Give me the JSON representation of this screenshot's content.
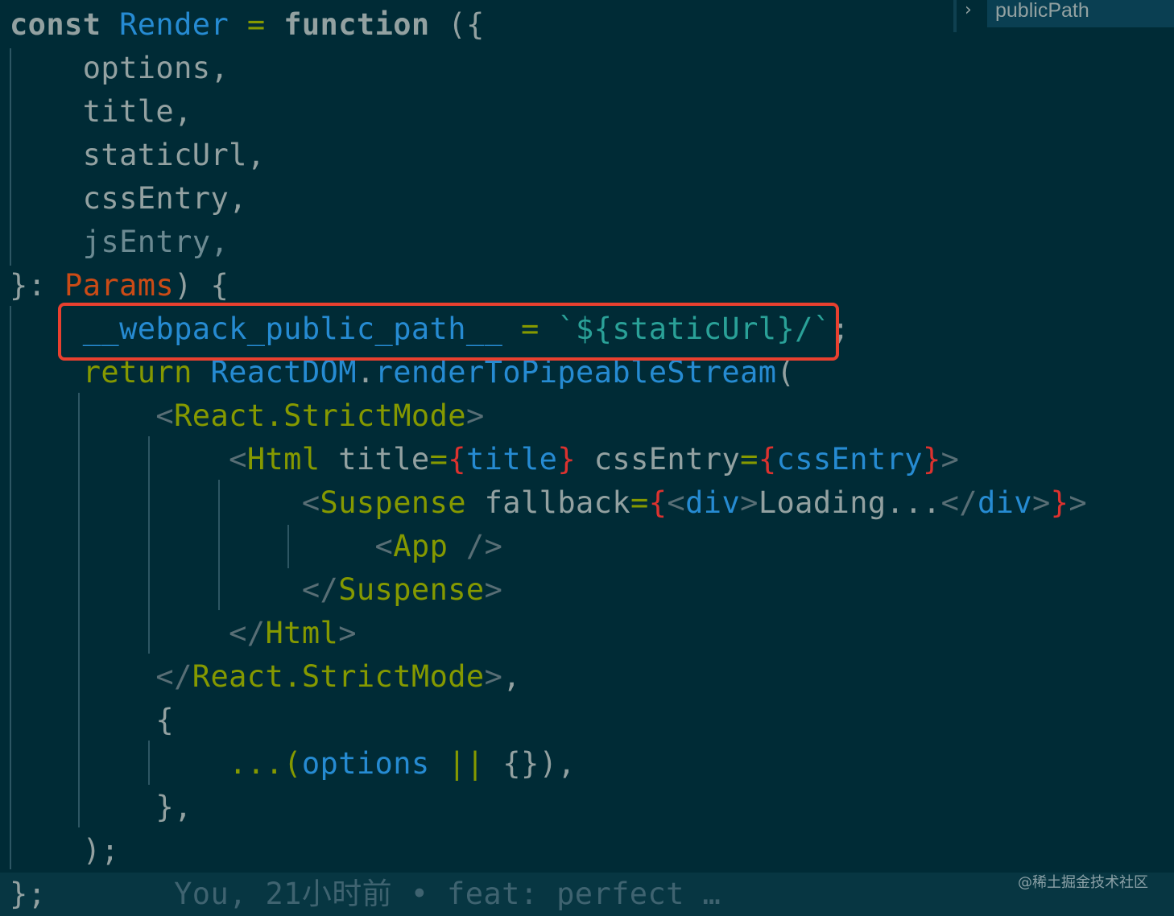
{
  "breadcrumb": {
    "chevron": "›",
    "item": "publicPath"
  },
  "code": {
    "l1": {
      "kw": "const",
      "name": "Render",
      "eq": "=",
      "fn": "function",
      "open": " ({"
    },
    "l2": "options,",
    "l3": "title,",
    "l4": "staticUrl,",
    "l5": "cssEntry,",
    "l6": "jsEntry,",
    "l7": {
      "close": "}: ",
      "type": "Params",
      "rest": ") {"
    },
    "l8": {
      "var": "__webpack_public_path__",
      "eq": " = ",
      "tpl_open": "`",
      "tpl_expr": "${staticUrl}",
      "tpl_tail": "/`",
      "semi": ";"
    },
    "l9": {
      "kw": "return",
      "obj": "ReactDOM",
      "dot": ".",
      "method": "renderToPipeableStream",
      "paren": "("
    },
    "l10": {
      "lt": "<",
      "tag": "React.StrictMode",
      "gt": ">"
    },
    "l11": {
      "lt": "<",
      "tag": "Html",
      "attr1": " title",
      "eq1": "=",
      "b1o": "{",
      "v1": "title",
      "b1c": "}",
      "attr2": " cssEntry",
      "eq2": "=",
      "b2o": "{",
      "v2": "cssEntry",
      "b2c": "}",
      "gt": ">"
    },
    "l12": {
      "lt": "<",
      "tag": "Suspense",
      "attr": " fallback",
      "eq": "=",
      "bo": "{",
      "dlt": "<",
      "div": "div",
      "dgt": ">",
      "text": "Loading...",
      "clt": "</",
      "cdiv": "div",
      "cgt": ">",
      "bc": "}",
      "gt": ">"
    },
    "l13": {
      "lt": "<",
      "tag": "App",
      "end": " />"
    },
    "l14": {
      "lt": "</",
      "tag": "Suspense",
      "gt": ">"
    },
    "l15": {
      "lt": "</",
      "tag": "Html",
      "gt": ">"
    },
    "l16": {
      "lt": "</",
      "tag": "React.StrictMode",
      "gt": ">",
      "comma": ","
    },
    "l17": "{",
    "l18": {
      "spread": "...(",
      "var": "options",
      "op": " ||",
      "rest": " {}),"
    },
    "l19": "},",
    "l20": ");",
    "l21": "};"
  },
  "blame": "You, 21小时前 • feat: perfect …",
  "watermark": "@稀土掘金技术社区",
  "colors": {
    "background": "#002b36",
    "keyword": "#859900",
    "identifier": "#268bd2",
    "string": "#2aa198",
    "type": "#cb4b16",
    "brace": "#dc322f",
    "highlight_box": "#e8402f"
  }
}
